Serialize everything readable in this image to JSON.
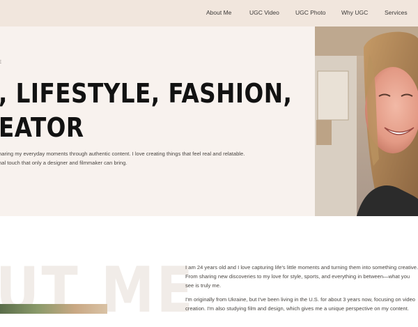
{
  "nav": {
    "items": [
      "About Me",
      "UGC Video",
      "UGC Photo",
      "Why UGC",
      "Services"
    ]
  },
  "hero": {
    "eyebrow": "E",
    "headline_line1": ", LIFESTYLE, FASHION,",
    "headline_line2": "EATOR",
    "intro_line1": "haring my everyday moments through authentic content. I love creating things that feel real and relatable.",
    "intro_line2": "nal touch that only a designer and filmmaker can bring."
  },
  "about": {
    "watermark": "UT ME",
    "paragraph1": "I am 24 years old and I love capturing life's little moments and turning them into something creative. From sharing new discoveries to my love for style, sports, and everything in between—what you see is truly me.",
    "paragraph2": "I'm originally from Ukraine, but I've been living in the U.S. for about 3 years now, focusing on video creation. I'm also studying film and design, which gives me a unique perspective on my content."
  },
  "colors": {
    "nav_bg": "#f1e6dd",
    "hero_bg": "#f8f2ee",
    "headline": "#121212"
  }
}
